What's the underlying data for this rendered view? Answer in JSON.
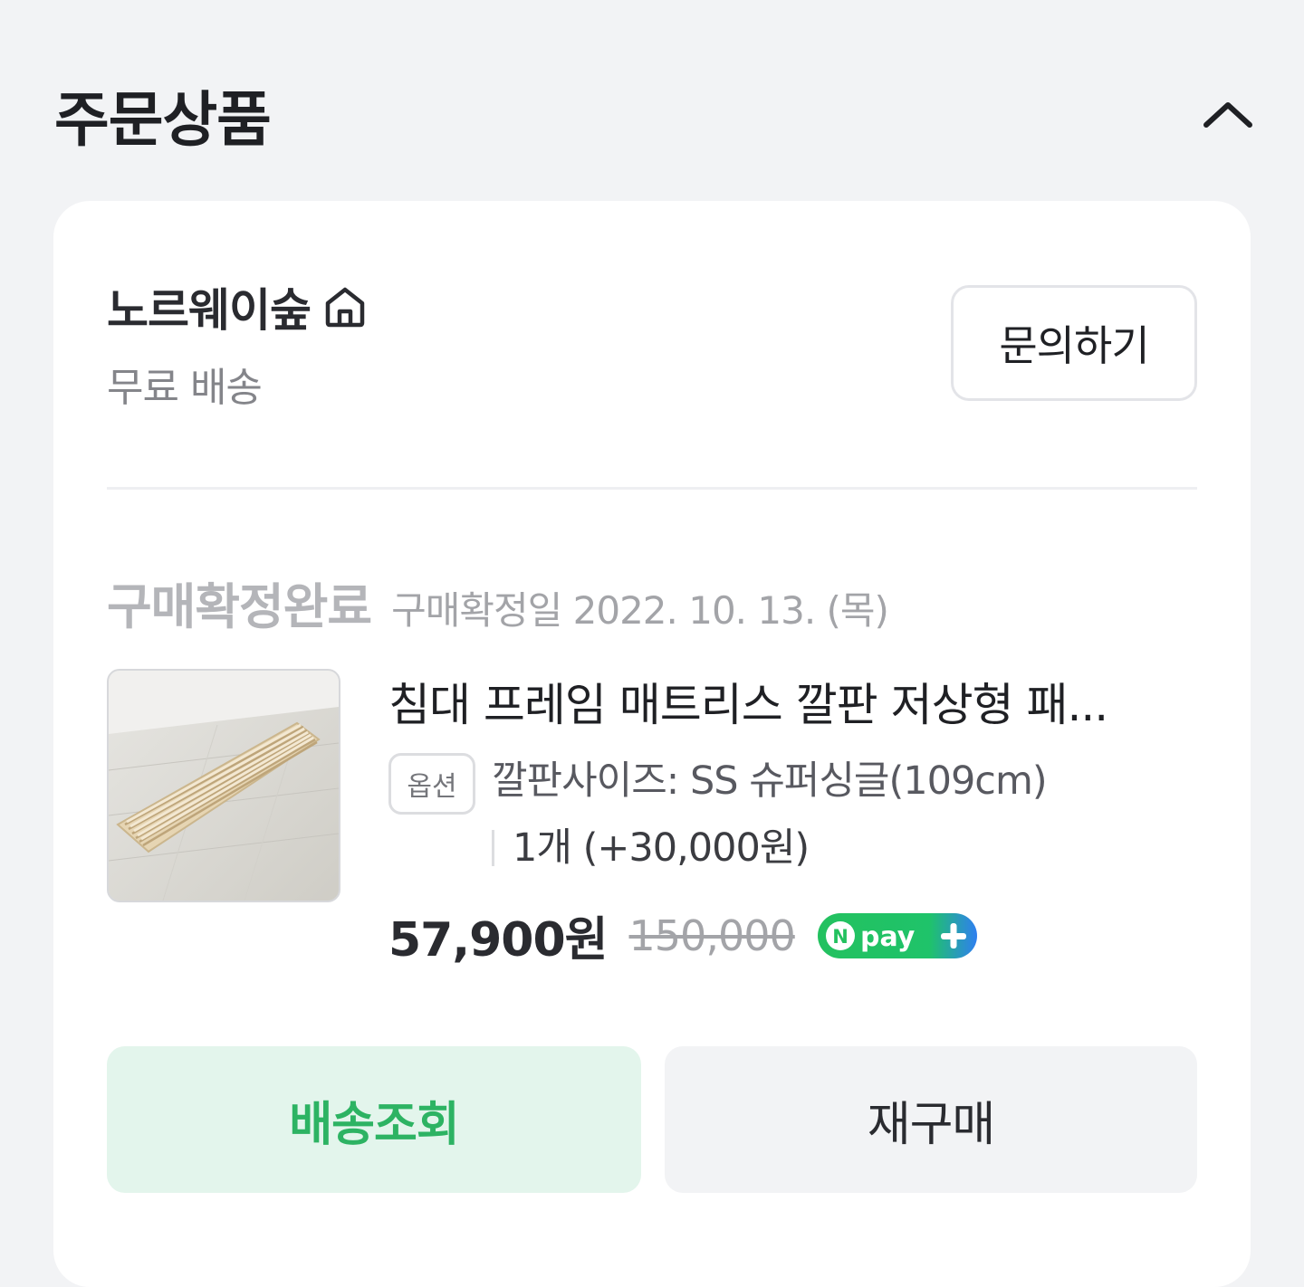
{
  "section": {
    "title": "주문상품"
  },
  "seller": {
    "name": "노르웨이숲",
    "shipping": "무료 배송",
    "inquiry_label": "문의하기"
  },
  "order": {
    "status": "구매확정완료",
    "status_date": "구매확정일 2022. 10. 13. (목)"
  },
  "product": {
    "name": "침대 프레임 매트리스 깔판 저상형 패...",
    "option_badge": "옵션",
    "option_text": "깔판사이즈: SS 슈퍼싱글(109cm)",
    "quantity_text": "1개 (+30,000원)",
    "price": "57,900원",
    "original_price": "150,000",
    "pay_badge": "Npay+"
  },
  "actions": {
    "track_label": "배송조회",
    "rebuy_label": "재구매"
  },
  "colors": {
    "background": "#f2f3f5",
    "accent_green": "#2db363",
    "track_button_bg": "#e3f5ec"
  },
  "icons": {
    "collapse": "chevron-up-icon",
    "store": "home-icon",
    "pay": "npay-plus-badge"
  }
}
